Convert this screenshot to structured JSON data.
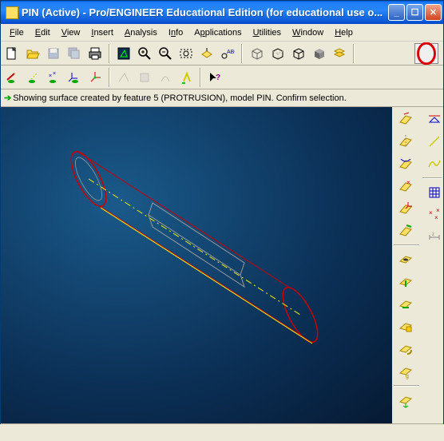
{
  "window": {
    "title": "PIN (Active) - Pro/ENGINEER Educational Edition (for educational use o..."
  },
  "menu": {
    "file": "File",
    "edit": "Edit",
    "view": "View",
    "insert": "Insert",
    "analysis": "Analysis",
    "info": "Info",
    "applications": "Applications",
    "utilities": "Utilities",
    "window": "Window",
    "help": "Help"
  },
  "message": {
    "text": "Showing surface created by feature 5 (PROTRUSION), model PIN.  Confirm selection."
  },
  "icons": {
    "new": "new-file",
    "open": "open-file",
    "save": "save",
    "saveall": "save-all",
    "print": "print",
    "repaint": "repaint",
    "zoomin": "zoom-in",
    "zoomout": "zoom-out",
    "refit": "refit",
    "orient": "orient",
    "abc": "text-display",
    "wire": "wireframe",
    "hidden": "hidden-line",
    "nohidden": "no-hidden",
    "shade": "shaded",
    "layers": "layers"
  }
}
